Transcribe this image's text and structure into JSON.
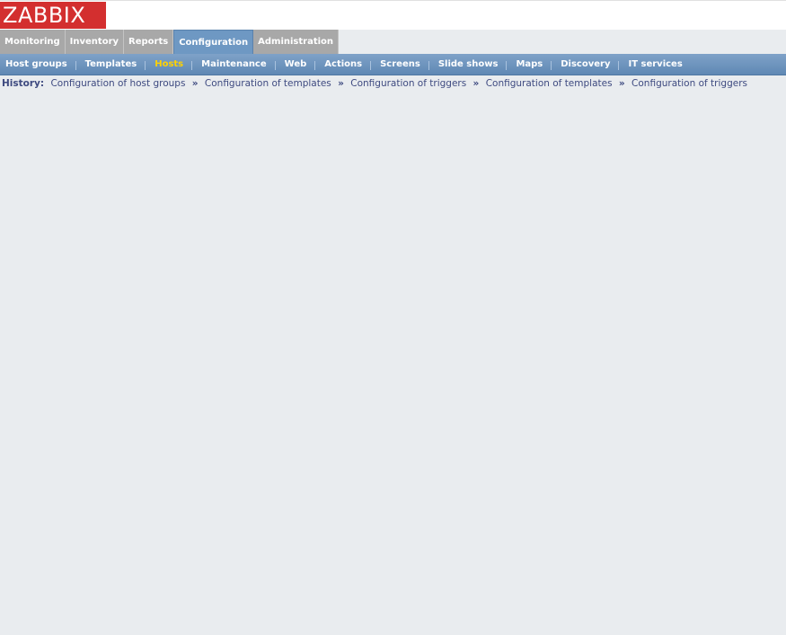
{
  "logo": {
    "text": "ZABBIX"
  },
  "main_menu": {
    "tabs": [
      {
        "label": "Monitoring"
      },
      {
        "label": "Inventory"
      },
      {
        "label": "Reports"
      },
      {
        "label": "Configuration",
        "active": true
      },
      {
        "label": "Administration"
      }
    ]
  },
  "sub_menu": {
    "items": [
      {
        "label": "Host groups"
      },
      {
        "label": "Templates"
      },
      {
        "label": "Hosts",
        "active": true
      },
      {
        "label": "Maintenance"
      },
      {
        "label": "Web"
      },
      {
        "label": "Actions"
      },
      {
        "label": "Screens"
      },
      {
        "label": "Slide shows"
      },
      {
        "label": "Maps"
      },
      {
        "label": "Discovery"
      },
      {
        "label": "IT services"
      }
    ]
  },
  "history": {
    "label": "History:",
    "separator": "»",
    "links": [
      "Configuration of host groups",
      "Configuration of templates",
      "Configuration of triggers",
      "Configuration of templates",
      "Configuration of triggers"
    ]
  },
  "colors": {
    "logo_bg": "#D32F2F",
    "tab_bg": "#A8A8A8",
    "tab_active_bg": "#6E98C3",
    "submenu_bg": "#6F96BE",
    "submenu_active_text": "#FFD200",
    "page_bg": "#E9ECEF",
    "history_text": "#3E4A80"
  }
}
